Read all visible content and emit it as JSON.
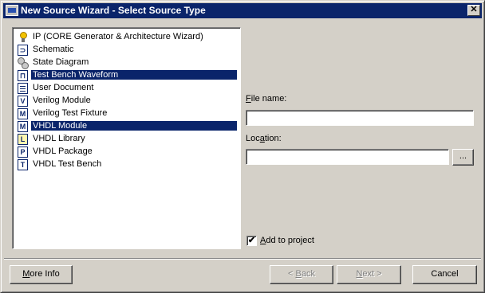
{
  "window": {
    "title": "New Source Wizard - Select Source Type",
    "close_glyph": "✕"
  },
  "source_types": [
    {
      "label": "IP (CORE Generator & Architecture Wizard)",
      "icon": "ip-bulb-icon",
      "selected": false
    },
    {
      "label": "Schematic",
      "icon": "schematic-icon",
      "selected": false
    },
    {
      "label": "State Diagram",
      "icon": "state-diagram-icon",
      "selected": false
    },
    {
      "label": "Test Bench Waveform",
      "icon": "waveform-icon",
      "selected": true
    },
    {
      "label": "User Document",
      "icon": "document-icon",
      "selected": false
    },
    {
      "label": "Verilog Module",
      "icon": "verilog-icon",
      "selected": false
    },
    {
      "label": "Verilog Test Fixture",
      "icon": "verilog-fixture-icon",
      "selected": false
    },
    {
      "label": "VHDL Module",
      "icon": "vhdl-module-icon",
      "selected": true
    },
    {
      "label": "VHDL Library",
      "icon": "vhdl-library-icon",
      "selected": false
    },
    {
      "label": "VHDL Package",
      "icon": "vhdl-package-icon",
      "selected": false
    },
    {
      "label": "VHDL Test Bench",
      "icon": "vhdl-testbench-icon",
      "selected": false
    }
  ],
  "file_name": {
    "label_prefix": "F",
    "label_rest": "ile name:",
    "value": ""
  },
  "location": {
    "label_prefix": "Loc",
    "label_accel": "a",
    "label_rest": "tion:",
    "value": "",
    "browse_label": "..."
  },
  "add_to_project": {
    "label_accel": "A",
    "label_rest": "dd to project",
    "checked": true,
    "check_glyph": "✔"
  },
  "buttons": {
    "more_info_accel": "M",
    "more_info_rest": "ore Info",
    "back_prefix": "< ",
    "back_accel": "B",
    "back_rest": "ack",
    "next_accel": "N",
    "next_rest": "ext >",
    "cancel": "Cancel"
  }
}
